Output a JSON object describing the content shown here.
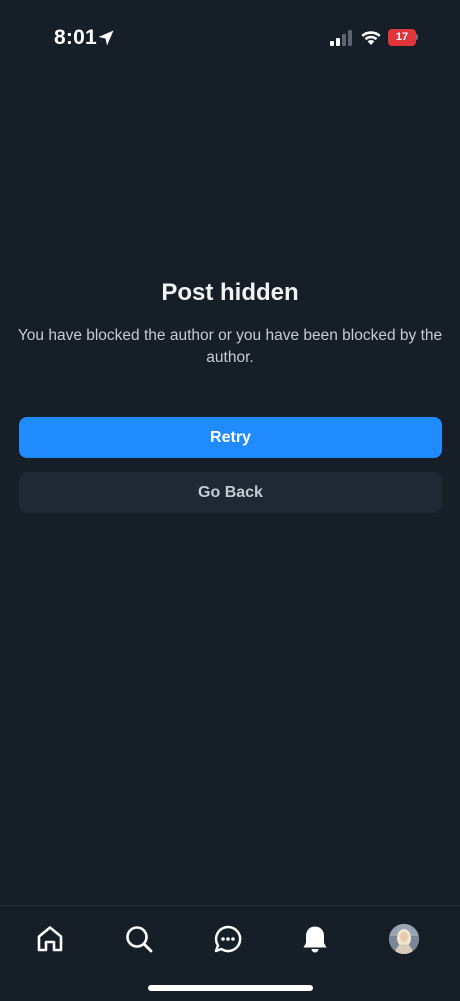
{
  "status_bar": {
    "time": "8:01",
    "battery_level": "17",
    "battery_color": "#e0353b",
    "icons": [
      "location-arrow-icon",
      "cellular-signal-icon",
      "wifi-icon",
      "battery-charging-icon"
    ]
  },
  "main": {
    "title": "Post hidden",
    "message": "You have blocked the author or you have been blocked by the author.",
    "retry_label": "Retry",
    "back_label": "Go Back"
  },
  "bottom_nav": {
    "items": [
      {
        "icon": "home-icon"
      },
      {
        "icon": "search-icon"
      },
      {
        "icon": "chat-icon"
      },
      {
        "icon": "bell-icon"
      },
      {
        "icon": "avatar"
      }
    ]
  },
  "colors": {
    "background": "#161e27",
    "accent": "#208bfe",
    "secondary_button": "#1e2935",
    "text_primary": "#f1f3f5",
    "text_secondary": "#c5cbd3"
  }
}
